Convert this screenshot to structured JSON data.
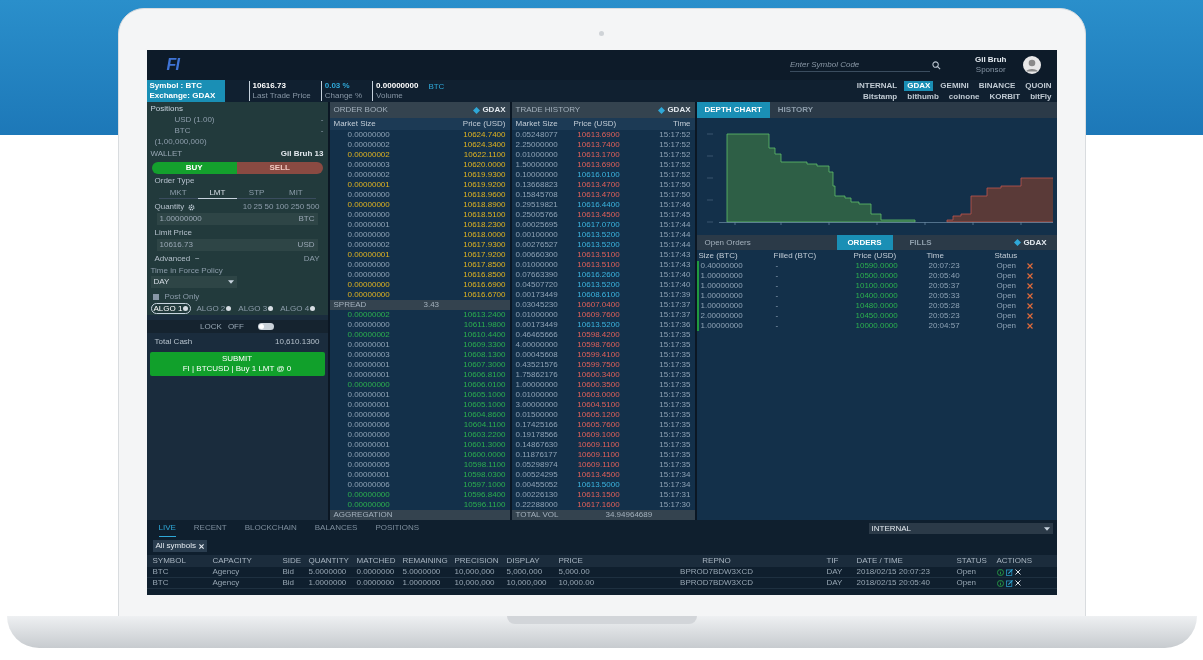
{
  "header": {
    "logo": "FI",
    "search": {
      "placeholder": "Enter Symbol Code"
    },
    "user": {
      "name": "Gil Bruh",
      "role": "Sponsor"
    }
  },
  "ticker": {
    "symbol": "Symbol : BTC",
    "exchange": "Exchange: GDAX",
    "stats": [
      {
        "value": "10616.73",
        "label": "Last Trade Price"
      },
      {
        "value": "0.03 %",
        "label": "Change %"
      },
      {
        "value": "0.00000000",
        "label": "Volume"
      }
    ],
    "unit": "BTC"
  },
  "exchange_rows": [
    [
      {
        "label": "INTERNAL",
        "selected": false
      },
      {
        "label": "GDAX",
        "selected": true
      },
      {
        "label": "GEMINI",
        "selected": false
      },
      {
        "label": "BINANCE",
        "selected": false
      },
      {
        "label": "QUOIN",
        "selected": false
      }
    ],
    [
      {
        "label": "Bitstamp",
        "selected": false
      },
      {
        "label": "bithumb",
        "selected": false
      },
      {
        "label": "coinone",
        "selected": false
      },
      {
        "label": "KORBIT",
        "selected": false
      },
      {
        "label": "bitFly",
        "selected": false
      }
    ]
  ],
  "order_panel": {
    "positions": {
      "title": "Positions",
      "rows": [
        {
          "label": "USD (1.00)",
          "value": "-"
        },
        {
          "label": "BTC",
          "value": "-"
        }
      ],
      "note": "(1,00,000,000)"
    },
    "wallet": {
      "label": "WALLET",
      "value": "Gil Bruh 13"
    },
    "sides": [
      {
        "label": "BUY",
        "selected": true
      },
      {
        "label": "SELL",
        "selected": false
      }
    ],
    "order_type": {
      "label": "Order Type",
      "options": [
        {
          "label": "MKT",
          "selected": false
        },
        {
          "label": "LMT",
          "selected": true
        },
        {
          "label": "STP",
          "selected": false
        },
        {
          "label": "MIT",
          "selected": false
        }
      ]
    },
    "quantity": {
      "label": "Quantity",
      "presets": [
        "10",
        "25",
        "50",
        "100",
        "250",
        "500"
      ],
      "value": "1.00000000",
      "unit": "BTC"
    },
    "limit_price": {
      "label": "Limit Price",
      "value": "10616.73",
      "unit": "USD"
    },
    "advanced": {
      "label": "Advanced",
      "toggle": "−",
      "tif": "DAY"
    },
    "tif_policy": {
      "label": "Time in Force Policy",
      "value": "DAY"
    },
    "post_only": {
      "label": "Post Only",
      "checked": true
    },
    "algos": [
      {
        "label": "ALGO 1",
        "selected": true
      },
      {
        "label": "ALGO 2",
        "selected": false
      },
      {
        "label": "ALGO 3",
        "selected": false
      },
      {
        "label": "ALGO 4",
        "selected": false
      }
    ],
    "lock": {
      "label": "LOCK",
      "state_text": "OFF",
      "on": false
    },
    "total_cash": {
      "label": "Total Cash",
      "value": "10,610.1300"
    },
    "submit": {
      "label": "SUBMIT",
      "summary": "FI | BTCUSD | Buy 1 LMT @ 0"
    }
  },
  "order_book": {
    "title": "ORDER BOOK",
    "exchange": "GDAX",
    "columns": [
      "Market Size",
      "Price (USD)"
    ],
    "asks": [
      {
        "size": "0.00000000",
        "price": "10624.7400",
        "highlight": false
      },
      {
        "size": "0.00000002",
        "price": "10624.3400",
        "highlight": false
      },
      {
        "size": "0.00000002",
        "price": "10622.1100",
        "highlight": true
      },
      {
        "size": "0.00000003",
        "price": "10620.0000",
        "highlight": false
      },
      {
        "size": "0.00000002",
        "price": "10619.9300",
        "highlight": false
      },
      {
        "size": "0.00000001",
        "price": "10619.9200",
        "highlight": true
      },
      {
        "size": "0.00000000",
        "price": "10618.9600",
        "highlight": false
      },
      {
        "size": "0.00000000",
        "price": "10618.8900",
        "highlight": true
      },
      {
        "size": "0.00000000",
        "price": "10618.5100",
        "highlight": false
      },
      {
        "size": "0.00000001",
        "price": "10618.2300",
        "highlight": false
      },
      {
        "size": "0.00000000",
        "price": "10618.0000",
        "highlight": false
      },
      {
        "size": "0.00000002",
        "price": "10617.9300",
        "highlight": false
      },
      {
        "size": "0.00000001",
        "price": "10617.9200",
        "highlight": true
      },
      {
        "size": "0.00000000",
        "price": "10617.8500",
        "highlight": false
      },
      {
        "size": "0.00000000",
        "price": "10616.8500",
        "highlight": false
      },
      {
        "size": "0.00000000",
        "price": "10616.6900",
        "highlight": true
      },
      {
        "size": "0.00000000",
        "price": "10616.6700",
        "highlight": true
      }
    ],
    "spread": {
      "label": "SPREAD",
      "value": "3.43"
    },
    "bids": [
      {
        "size": "0.00000002",
        "price": "10613.2400",
        "highlight": true
      },
      {
        "size": "0.00000000",
        "price": "10611.9800",
        "highlight": false
      },
      {
        "size": "0.00000002",
        "price": "10610.4400",
        "highlight": true
      },
      {
        "size": "0.00000001",
        "price": "10609.3300",
        "highlight": false
      },
      {
        "size": "0.00000003",
        "price": "10608.1300",
        "highlight": false
      },
      {
        "size": "0.00000001",
        "price": "10607.3000",
        "highlight": false
      },
      {
        "size": "0.00000001",
        "price": "10606.8100",
        "highlight": false
      },
      {
        "size": "0.00000000",
        "price": "10606.0100",
        "highlight": true
      },
      {
        "size": "0.00000001",
        "price": "10605.1000",
        "highlight": false
      },
      {
        "size": "0.00000001",
        "price": "10605.1000",
        "highlight": false
      },
      {
        "size": "0.00000006",
        "price": "10604.8600",
        "highlight": false
      },
      {
        "size": "0.00000006",
        "price": "10604.1100",
        "highlight": false
      },
      {
        "size": "0.00000000",
        "price": "10603.2200",
        "highlight": false
      },
      {
        "size": "0.00000001",
        "price": "10601.3000",
        "highlight": false
      },
      {
        "size": "0.00000000",
        "price": "10600.0000",
        "highlight": false
      },
      {
        "size": "0.00000005",
        "price": "10598.1100",
        "highlight": false
      },
      {
        "size": "0.00000001",
        "price": "10598.0300",
        "highlight": false
      },
      {
        "size": "0.00000006",
        "price": "10597.1000",
        "highlight": false
      },
      {
        "size": "0.00000000",
        "price": "10596.8400",
        "highlight": true
      },
      {
        "size": "0.00000000",
        "price": "10596.1100",
        "highlight": true
      }
    ],
    "footer": "AGGREGATION"
  },
  "trade_history": {
    "title": "TRADE HISTORY",
    "exchange": "GDAX",
    "columns": [
      "Market Size",
      "Price (USD)",
      "Time"
    ],
    "rows": [
      {
        "size": "0.05248077",
        "price": "10613.6900",
        "time": "15:17:52",
        "is_buy": false
      },
      {
        "size": "2.25000000",
        "price": "10613.7400",
        "time": "15:17:52",
        "is_buy": false
      },
      {
        "size": "0.01000000",
        "price": "10613.1700",
        "time": "15:17:52",
        "is_buy": false
      },
      {
        "size": "1.50000000",
        "price": "10613.6900",
        "time": "15:17:52",
        "is_buy": false
      },
      {
        "size": "0.10000000",
        "price": "10616.0100",
        "time": "15:17:52",
        "is_buy": true
      },
      {
        "size": "0.13668823",
        "price": "10613.4700",
        "time": "15:17:50",
        "is_buy": false
      },
      {
        "size": "0.15845708",
        "price": "10613.4700",
        "time": "15:17:50",
        "is_buy": false
      },
      {
        "size": "0.29519821",
        "price": "10616.4400",
        "time": "15:17:46",
        "is_buy": true
      },
      {
        "size": "0.25005766",
        "price": "10613.4500",
        "time": "15:17:45",
        "is_buy": false
      },
      {
        "size": "0.00025695",
        "price": "10617.0700",
        "time": "15:17:44",
        "is_buy": true
      },
      {
        "size": "0.00100000",
        "price": "10613.5200",
        "time": "15:17:44",
        "is_buy": true
      },
      {
        "size": "0.00276527",
        "price": "10613.5200",
        "time": "15:17:44",
        "is_buy": true
      },
      {
        "size": "0.00660300",
        "price": "10613.5100",
        "time": "15:17:43",
        "is_buy": false
      },
      {
        "size": "0.01000000",
        "price": "10613.5100",
        "time": "15:17:43",
        "is_buy": false
      },
      {
        "size": "0.07663390",
        "price": "10616.2600",
        "time": "15:17:40",
        "is_buy": true
      },
      {
        "size": "0.04507720",
        "price": "10613.5200",
        "time": "15:17:40",
        "is_buy": true
      },
      {
        "size": "0.00173449",
        "price": "10608.6100",
        "time": "15:17:39",
        "is_buy": true
      },
      {
        "size": "0.03045230",
        "price": "10607.0400",
        "time": "15:17:37",
        "is_buy": false
      },
      {
        "size": "0.01000000",
        "price": "10609.7600",
        "time": "15:17:37",
        "is_buy": false
      },
      {
        "size": "0.00173449",
        "price": "10613.5200",
        "time": "15:17:36",
        "is_buy": true
      },
      {
        "size": "0.46465666",
        "price": "10598.4200",
        "time": "15:17:35",
        "is_buy": false
      },
      {
        "size": "4.00000000",
        "price": "10598.7600",
        "time": "15:17:35",
        "is_buy": false
      },
      {
        "size": "0.00045608",
        "price": "10599.4100",
        "time": "15:17:35",
        "is_buy": false
      },
      {
        "size": "0.43521576",
        "price": "10599.7500",
        "time": "15:17:35",
        "is_buy": false
      },
      {
        "size": "1.75862176",
        "price": "10600.3400",
        "time": "15:17:35",
        "is_buy": false
      },
      {
        "size": "1.00000000",
        "price": "10600.3500",
        "time": "15:17:35",
        "is_buy": false
      },
      {
        "size": "0.01000000",
        "price": "10603.0000",
        "time": "15:17:35",
        "is_buy": false
      },
      {
        "size": "3.00000000",
        "price": "10604.5100",
        "time": "15:17:35",
        "is_buy": false
      },
      {
        "size": "0.01500000",
        "price": "10605.1200",
        "time": "15:17:35",
        "is_buy": false
      },
      {
        "size": "0.17425166",
        "price": "10605.7600",
        "time": "15:17:35",
        "is_buy": false
      },
      {
        "size": "0.19178566",
        "price": "10609.1000",
        "time": "15:17:35",
        "is_buy": false
      },
      {
        "size": "0.14867630",
        "price": "10609.1100",
        "time": "15:17:35",
        "is_buy": false
      },
      {
        "size": "0.11876177",
        "price": "10609.1100",
        "time": "15:17:35",
        "is_buy": false
      },
      {
        "size": "0.05298974",
        "price": "10609.1100",
        "time": "15:17:35",
        "is_buy": false
      },
      {
        "size": "0.00524295",
        "price": "10613.4500",
        "time": "15:17:34",
        "is_buy": false
      },
      {
        "size": "0.00455052",
        "price": "10613.5000",
        "time": "15:17:34",
        "is_buy": true
      },
      {
        "size": "0.00226130",
        "price": "10613.1500",
        "time": "15:17:31",
        "is_buy": false
      },
      {
        "size": "0.22288000",
        "price": "10617.1600",
        "time": "15:17:30",
        "is_buy": false
      }
    ],
    "footer": {
      "label": "TOTAL VOL",
      "value": "34.94964689"
    }
  },
  "chart_tabs": [
    {
      "label": "DEPTH CHART",
      "selected": true
    },
    {
      "label": "HISTORY",
      "selected": false
    }
  ],
  "open_orders": {
    "title": "Open Orders",
    "tabs": [
      {
        "label": "ORDERS",
        "selected": true
      },
      {
        "label": "FILLS",
        "selected": false
      }
    ],
    "exchange": "GDAX",
    "columns": [
      "Size (BTC)",
      "Filled (BTC)",
      "Price (USD)",
      "Time",
      "Status"
    ],
    "rows": [
      {
        "size": "0.40000000",
        "filled": "-",
        "price": "10590.0000",
        "time": "20:07:23",
        "status": "Open"
      },
      {
        "size": "1.00000000",
        "filled": "-",
        "price": "10500.0000",
        "time": "20:05:40",
        "status": "Open"
      },
      {
        "size": "1.00000000",
        "filled": "-",
        "price": "10100.0000",
        "time": "20:05:37",
        "status": "Open"
      },
      {
        "size": "1.00000000",
        "filled": "-",
        "price": "10400.0000",
        "time": "20:05:33",
        "status": "Open"
      },
      {
        "size": "1.00000000",
        "filled": "-",
        "price": "10480.0000",
        "time": "20:05:28",
        "status": "Open"
      },
      {
        "size": "2.00000000",
        "filled": "-",
        "price": "10450.0000",
        "time": "20:05:23",
        "status": "Open"
      },
      {
        "size": "1.00000000",
        "filled": "-",
        "price": "10000.0000",
        "time": "20:04:57",
        "status": "Open"
      }
    ]
  },
  "bottom": {
    "tabs": [
      {
        "label": "LIVE",
        "selected": true
      },
      {
        "label": "RECENT",
        "selected": false
      },
      {
        "label": "BLOCKCHAIN",
        "selected": false
      },
      {
        "label": "BALANCES",
        "selected": false
      },
      {
        "label": "POSITIONS",
        "selected": false
      }
    ],
    "venue": "INTERNAL",
    "filter": "All symbols",
    "columns": [
      "SYMBOL",
      "CAPACITY",
      "SIDE",
      "QUANTITY",
      "MATCHED",
      "REMAINING",
      "PRECISION",
      "DISPLAY",
      "PRICE",
      "REPNO",
      "TIF",
      "DATE / TIME",
      "STATUS",
      "ACTIONS"
    ],
    "rows": [
      {
        "cells": [
          "BTC",
          "Agency",
          "Bid",
          "5.0000000",
          "0.0000000",
          "5.0000000",
          "10,000,000",
          "5,000,000",
          "5,000.00",
          "BPROD7BDW3XCD",
          "DAY",
          "2018/02/15 20:07:23",
          "Open"
        ]
      },
      {
        "cells": [
          "BTC",
          "Agency",
          "Bid",
          "1.0000000",
          "0.0000000",
          "1.0000000",
          "10,000,000",
          "10,000,000",
          "10,000.00",
          "BPROD7BDW3XCD",
          "DAY",
          "2018/02/15 20:05:40",
          "Open"
        ]
      }
    ]
  }
}
